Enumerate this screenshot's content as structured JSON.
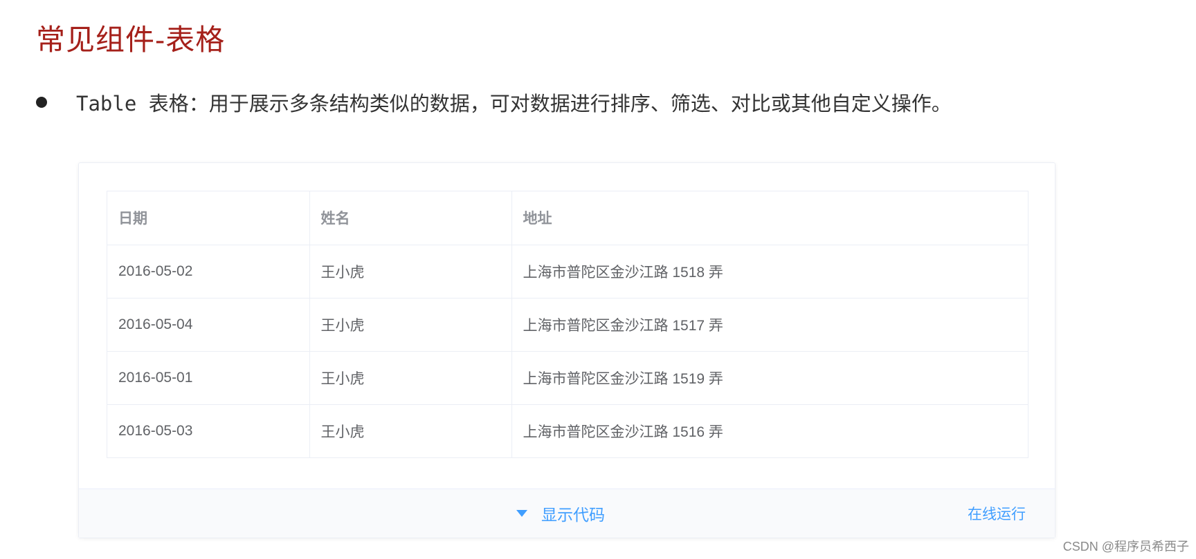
{
  "title": "常见组件-表格",
  "bullet": {
    "text": "Table 表格：用于展示多条结构类似的数据，可对数据进行排序、筛选、对比或其他自定义操作。"
  },
  "table": {
    "headers": [
      "日期",
      "姓名",
      "地址"
    ],
    "rows": [
      [
        "2016-05-02",
        "王小虎",
        "上海市普陀区金沙江路 1518 弄"
      ],
      [
        "2016-05-04",
        "王小虎",
        "上海市普陀区金沙江路 1517 弄"
      ],
      [
        "2016-05-01",
        "王小虎",
        "上海市普陀区金沙江路 1519 弄"
      ],
      [
        "2016-05-03",
        "王小虎",
        "上海市普陀区金沙江路 1516 弄"
      ]
    ]
  },
  "footer": {
    "toggle_label": "显示代码",
    "run_label": "在线运行"
  },
  "watermark": "CSDN @程序员希西子",
  "colors": {
    "title": "#a5201a",
    "link": "#409eff",
    "header_text": "#909399",
    "cell_text": "#606266",
    "border": "#ebeef5"
  }
}
